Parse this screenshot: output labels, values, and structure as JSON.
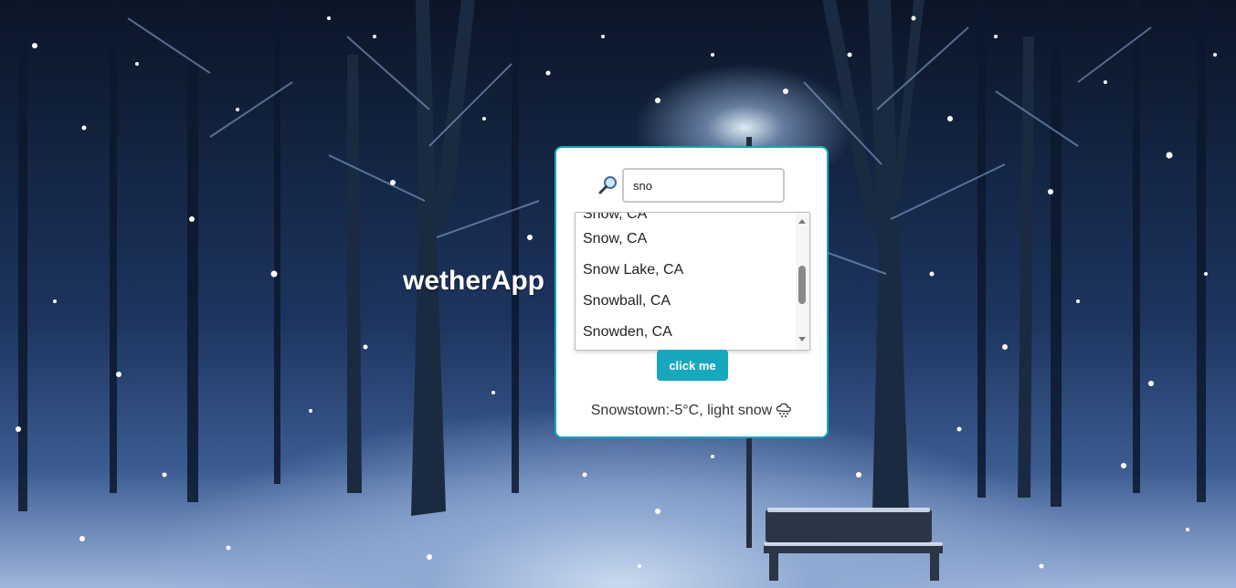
{
  "app": {
    "title": "wetherApp"
  },
  "search": {
    "value": "sno",
    "placeholder": "",
    "icon": "magnifying-glass-icon"
  },
  "autocomplete": {
    "partial_item": "Snow, CA",
    "items": [
      {
        "label": "Snow, CA"
      },
      {
        "label": "Snow Lake, CA"
      },
      {
        "label": "Snowball, CA"
      },
      {
        "label": "Snowden, CA"
      }
    ],
    "scroll_position": 0.55
  },
  "button": {
    "label": "click me"
  },
  "result": {
    "text": "Snowstown:-5°C, light snow",
    "icon": "snow-cloud-icon"
  },
  "colors": {
    "accent": "#17a8be",
    "card_border": "#1aa6b7",
    "title": "#ffffff"
  }
}
